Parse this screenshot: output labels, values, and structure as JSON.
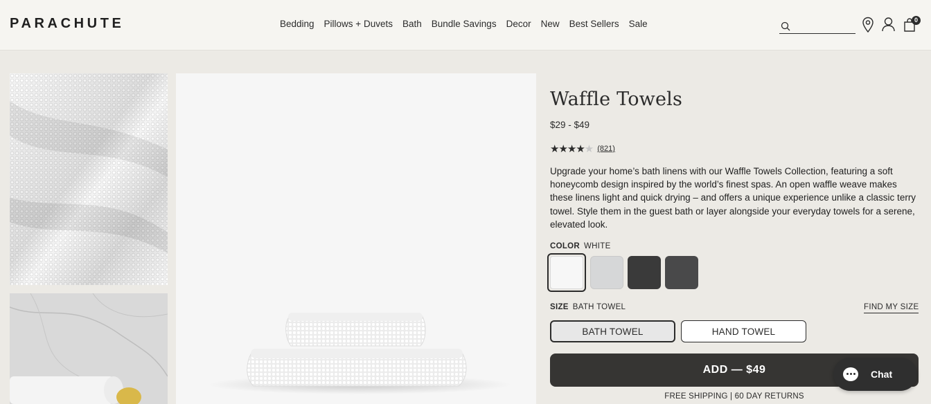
{
  "header": {
    "logo": "PARACHUTE",
    "nav": [
      "Bedding",
      "Pillows + Duvets",
      "Bath",
      "Bundle Savings",
      "Decor",
      "New",
      "Best Sellers",
      "Sale"
    ],
    "search_placeholder": "",
    "cart_count": "0",
    "icons": [
      "search-icon",
      "location-pin-icon",
      "account-icon",
      "shopping-bag-icon"
    ]
  },
  "product": {
    "title": "Waffle Towels",
    "price": "$29 - $49",
    "rating_value": 4.5,
    "review_count": "(821)",
    "description": "Upgrade your home’s bath linens with our Waffle Towels Collection, featuring a soft honeycomb design inspired by the world’s finest spas. An open waffle weave makes these linens light and quick drying – and offers a unique experience unlike a classic terry towel. Style them in the guest bath or layer alongside your everyday towels for a serene, elevated look.",
    "color_label": "COLOR",
    "color_value": "WHITE",
    "swatches": [
      {
        "name": "White",
        "color": "#f7f7f7",
        "selected": true
      },
      {
        "name": "Light Grey",
        "color": "#d6d7d8",
        "selected": false
      },
      {
        "name": "Charcoal",
        "color": "#3a3a3a",
        "selected": false
      },
      {
        "name": "Dark Grey",
        "color": "#49494a",
        "selected": false
      }
    ],
    "size_label": "SIZE",
    "size_value": "BATH TOWEL",
    "find_size": "FIND MY SIZE",
    "sizes": [
      {
        "label": "BATH TOWEL",
        "selected": true
      },
      {
        "label": "HAND TOWEL",
        "selected": false
      }
    ],
    "add_button": "ADD — $49",
    "shipping": "FREE SHIPPING | 60 DAY RETURNS"
  },
  "chat": {
    "label": "Chat"
  },
  "colors": {
    "accent": "#363533",
    "page_bg": "#eceae5",
    "header_bg": "#f6f5f1"
  }
}
